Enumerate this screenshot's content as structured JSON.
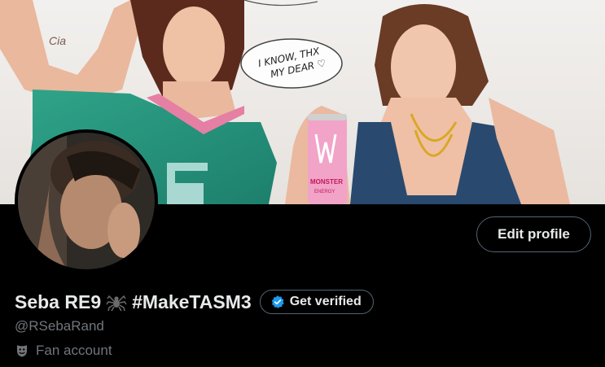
{
  "banner": {
    "speech_bubble_text_line1": "I KNOW, THX",
    "speech_bubble_text_line2": "MY DEAR ♡",
    "can_text_line1": "MONSTER",
    "can_text_line2": "ENERGY",
    "tattoo_text": "Cia"
  },
  "profile": {
    "display_name": "Seba RE9",
    "name_emoji": "spider-icon",
    "name_hashtag": "#MakeTASM3",
    "handle": "@RSebaRand",
    "category_icon": "theater-masks-icon",
    "category": "Fan account"
  },
  "actions": {
    "edit_profile_label": "Edit profile",
    "get_verified_label": "Get verified",
    "verified_icon": "verified-badge-icon"
  },
  "colors": {
    "background": "#000000",
    "text_primary": "#e7e9ea",
    "text_secondary": "#71767b",
    "border": "#536471",
    "verified_blue": "#1d9bf0"
  }
}
